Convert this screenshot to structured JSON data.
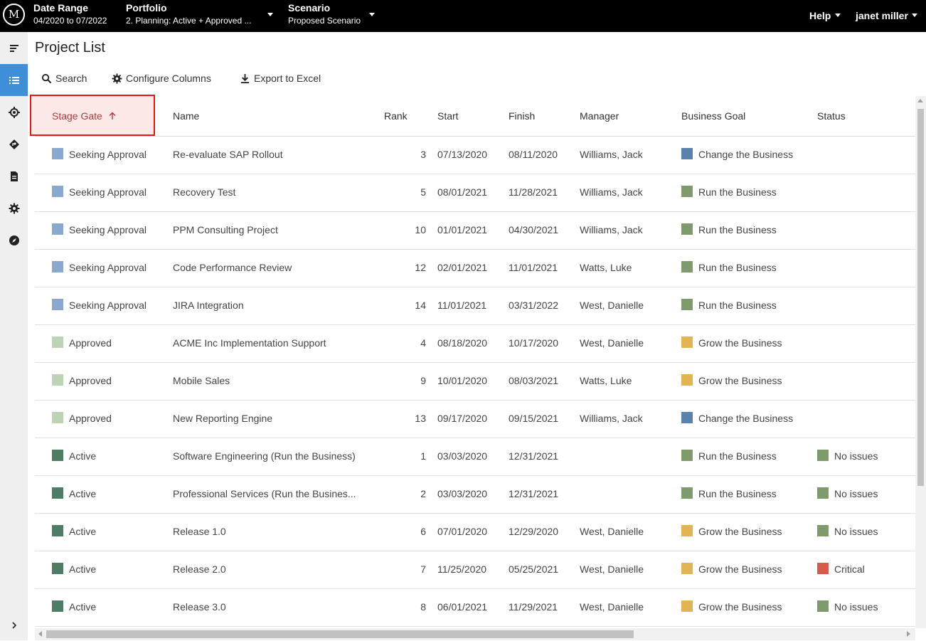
{
  "topbar": {
    "logo": "M",
    "date_range": {
      "label": "Date Range",
      "value": "04/2020 to 07/2022"
    },
    "portfolio": {
      "label": "Portfolio",
      "value": "2. Planning: Active + Approved ..."
    },
    "scenario": {
      "label": "Scenario",
      "value": "Proposed Scenario"
    },
    "help": "Help",
    "user": "janet miller"
  },
  "rail": [
    "menu-icon",
    "list-icon",
    "target-icon",
    "roadmap-icon",
    "document-icon",
    "gear-icon",
    "compass-icon",
    "chevron-right-icon"
  ],
  "page": {
    "title": "Project List",
    "toolbar": {
      "search": "Search",
      "configure": "Configure Columns",
      "export": "Export to Excel"
    }
  },
  "columns": {
    "stage_gate": "Stage Gate",
    "name": "Name",
    "rank": "Rank",
    "start": "Start",
    "finish": "Finish",
    "manager": "Manager",
    "goal": "Business Goal",
    "status": "Status"
  },
  "colors": {
    "seeking": "#8aa8cf",
    "approved": "#bcd3b4",
    "active": "#4e7d65",
    "change": "#5a82ad",
    "run": "#7f9a6c",
    "grow": "#e3b552",
    "ok": "#7f9a6c",
    "critical": "#d9584a",
    "highlight": "#e0191f"
  },
  "rows": [
    {
      "stage": "Seeking Approval",
      "stage_color": "#8aa8cf",
      "name": "Re-evaluate SAP Rollout",
      "rank": "3",
      "start": "07/13/2020",
      "finish": "08/11/2020",
      "manager": "Williams, Jack",
      "goal": "Change the Business",
      "goal_color": "#5a82ad",
      "status": "",
      "status_color": ""
    },
    {
      "stage": "Seeking Approval",
      "stage_color": "#8aa8cf",
      "name": "Recovery Test",
      "rank": "5",
      "start": "08/01/2021",
      "finish": "11/28/2021",
      "manager": "Williams, Jack",
      "goal": "Run the Business",
      "goal_color": "#7f9a6c",
      "status": "",
      "status_color": ""
    },
    {
      "stage": "Seeking Approval",
      "stage_color": "#8aa8cf",
      "name": "PPM Consulting Project",
      "rank": "10",
      "start": "01/01/2021",
      "finish": "04/30/2021",
      "manager": "Williams, Jack",
      "goal": "Run the Business",
      "goal_color": "#7f9a6c",
      "status": "",
      "status_color": ""
    },
    {
      "stage": "Seeking Approval",
      "stage_color": "#8aa8cf",
      "name": "Code Performance Review",
      "rank": "12",
      "start": "02/01/2021",
      "finish": "11/01/2021",
      "manager": "Watts, Luke",
      "goal": "Run the Business",
      "goal_color": "#7f9a6c",
      "status": "",
      "status_color": ""
    },
    {
      "stage": "Seeking Approval",
      "stage_color": "#8aa8cf",
      "name": "JIRA Integration",
      "rank": "14",
      "start": "11/01/2021",
      "finish": "03/31/2022",
      "manager": "West, Danielle",
      "goal": "Run the Business",
      "goal_color": "#7f9a6c",
      "status": "",
      "status_color": ""
    },
    {
      "stage": "Approved",
      "stage_color": "#bcd3b4",
      "name": "ACME Inc Implementation Support",
      "rank": "4",
      "start": "08/18/2020",
      "finish": "10/17/2020",
      "manager": "West, Danielle",
      "goal": "Grow the Business",
      "goal_color": "#e3b552",
      "status": "",
      "status_color": ""
    },
    {
      "stage": "Approved",
      "stage_color": "#bcd3b4",
      "name": "Mobile Sales",
      "rank": "9",
      "start": "10/01/2020",
      "finish": "08/03/2021",
      "manager": "Watts, Luke",
      "goal": "Grow the Business",
      "goal_color": "#e3b552",
      "status": "",
      "status_color": ""
    },
    {
      "stage": "Approved",
      "stage_color": "#bcd3b4",
      "name": "New Reporting Engine",
      "rank": "13",
      "start": "09/17/2020",
      "finish": "09/15/2021",
      "manager": "Williams, Jack",
      "goal": "Change the Business",
      "goal_color": "#5a82ad",
      "status": "",
      "status_color": ""
    },
    {
      "stage": "Active",
      "stage_color": "#4e7d65",
      "name": "Software Engineering (Run the Business)",
      "rank": "1",
      "start": "03/03/2020",
      "finish": "12/31/2021",
      "manager": "",
      "goal": "Run the Business",
      "goal_color": "#7f9a6c",
      "status": "No issues",
      "status_color": "#7f9a6c"
    },
    {
      "stage": "Active",
      "stage_color": "#4e7d65",
      "name": "Professional Services (Run the Busines...",
      "rank": "2",
      "start": "03/03/2020",
      "finish": "12/31/2021",
      "manager": "",
      "goal": "Run the Business",
      "goal_color": "#7f9a6c",
      "status": "No issues",
      "status_color": "#7f9a6c"
    },
    {
      "stage": "Active",
      "stage_color": "#4e7d65",
      "name": "Release 1.0",
      "rank": "6",
      "start": "07/01/2020",
      "finish": "12/29/2020",
      "manager": "West, Danielle",
      "goal": "Grow the Business",
      "goal_color": "#e3b552",
      "status": "No issues",
      "status_color": "#7f9a6c"
    },
    {
      "stage": "Active",
      "stage_color": "#4e7d65",
      "name": "Release 2.0",
      "rank": "7",
      "start": "11/25/2020",
      "finish": "05/25/2021",
      "manager": "West, Danielle",
      "goal": "Grow the Business",
      "goal_color": "#e3b552",
      "status": "Critical",
      "status_color": "#d9584a"
    },
    {
      "stage": "Active",
      "stage_color": "#4e7d65",
      "name": "Release 3.0",
      "rank": "8",
      "start": "06/01/2021",
      "finish": "11/29/2021",
      "manager": "West, Danielle",
      "goal": "Grow the Business",
      "goal_color": "#e3b552",
      "status": "No issues",
      "status_color": "#7f9a6c"
    }
  ]
}
